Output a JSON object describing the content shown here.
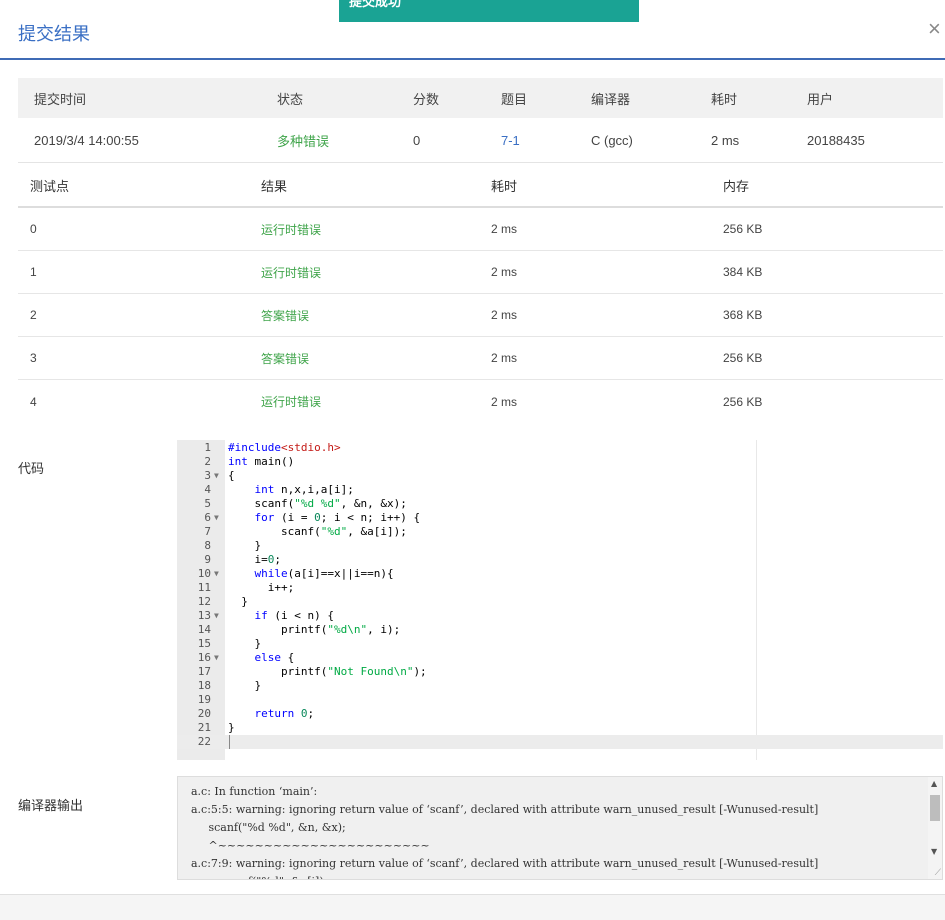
{
  "toast": {
    "text": "提交成功"
  },
  "modal": {
    "title": "提交结果",
    "close_symbol": "×"
  },
  "summary": {
    "headers": [
      "提交时间",
      "状态",
      "分数",
      "题目",
      "编译器",
      "耗时",
      "用户"
    ],
    "row": {
      "time": "2019/3/4 14:00:55",
      "status": "多种错误",
      "score": "0",
      "problem": "7-1",
      "compiler": "C (gcc)",
      "duration": "2 ms",
      "user": "20188435"
    }
  },
  "tests": {
    "headers": [
      "测试点",
      "结果",
      "耗时",
      "内存"
    ],
    "rows": [
      {
        "id": "0",
        "result": "运行时错误",
        "time": "2 ms",
        "memory": "256 KB"
      },
      {
        "id": "1",
        "result": "运行时错误",
        "time": "2 ms",
        "memory": "384 KB"
      },
      {
        "id": "2",
        "result": "答案错误",
        "time": "2 ms",
        "memory": "368 KB"
      },
      {
        "id": "3",
        "result": "答案错误",
        "time": "2 ms",
        "memory": "256 KB"
      },
      {
        "id": "4",
        "result": "运行时错误",
        "time": "2 ms",
        "memory": "256 KB"
      }
    ]
  },
  "code_section": {
    "label": "代码",
    "lines": [
      {
        "n": "1",
        "html": "<span class=\"kw\">#include</span><span class=\"inc\">&lt;stdio.h&gt;</span>"
      },
      {
        "n": "2",
        "html": "<span class=\"kw\">int</span> main()"
      },
      {
        "n": "3",
        "fold": true,
        "html": "{"
      },
      {
        "n": "4",
        "html": "    <span class=\"kw\">int</span> n,x,i,a[i];"
      },
      {
        "n": "5",
        "html": "    scanf(<span class=\"str\">\"%d %d\"</span>, &amp;n, &amp;x);"
      },
      {
        "n": "6",
        "fold": true,
        "html": "    <span class=\"kw\">for</span> (i = <span class=\"num\">0</span>; i &lt; n; i++) {"
      },
      {
        "n": "7",
        "html": "        scanf(<span class=\"str\">\"%d\"</span>, &amp;a[i]);"
      },
      {
        "n": "8",
        "html": "    }"
      },
      {
        "n": "9",
        "html": "    i=<span class=\"num\">0</span>;"
      },
      {
        "n": "10",
        "fold": true,
        "html": "    <span class=\"kw\">while</span>(a[i]==x||i==n){"
      },
      {
        "n": "11",
        "html": "      i++;"
      },
      {
        "n": "12",
        "html": "  }"
      },
      {
        "n": "13",
        "fold": true,
        "html": "    <span class=\"kw\">if</span> (i &lt; n) {"
      },
      {
        "n": "14",
        "html": "        printf(<span class=\"str\">\"%d\\n\"</span>, i);"
      },
      {
        "n": "15",
        "html": "    }"
      },
      {
        "n": "16",
        "fold": true,
        "html": "    <span class=\"kw\">else</span> {"
      },
      {
        "n": "17",
        "html": "        printf(<span class=\"str\">\"Not Found\\n\"</span>);"
      },
      {
        "n": "18",
        "html": "    }"
      },
      {
        "n": "19",
        "html": ""
      },
      {
        "n": "20",
        "html": "    <span class=\"kw\">return</span> <span class=\"num\">0</span>;"
      },
      {
        "n": "21",
        "html": "}"
      },
      {
        "n": "22",
        "html": "",
        "active": true
      }
    ]
  },
  "compiler_output": {
    "label": "编译器输出",
    "lines": [
      "a.c: In function ‘main’:",
      "a.c:5:5: warning: ignoring return value of ‘scanf’, declared with attribute warn_unused_result [-Wunused-result]",
      "     scanf(\"%d %d\", &n, &x);",
      "     ^~~~~~~~~~~~~~~~~~~~~~~~",
      "a.c:7:9: warning: ignoring return value of ‘scanf’, declared with attribute warn_unused_result [-Wunused-result]",
      "         scanf(\"%d\", &a[i]);"
    ]
  }
}
